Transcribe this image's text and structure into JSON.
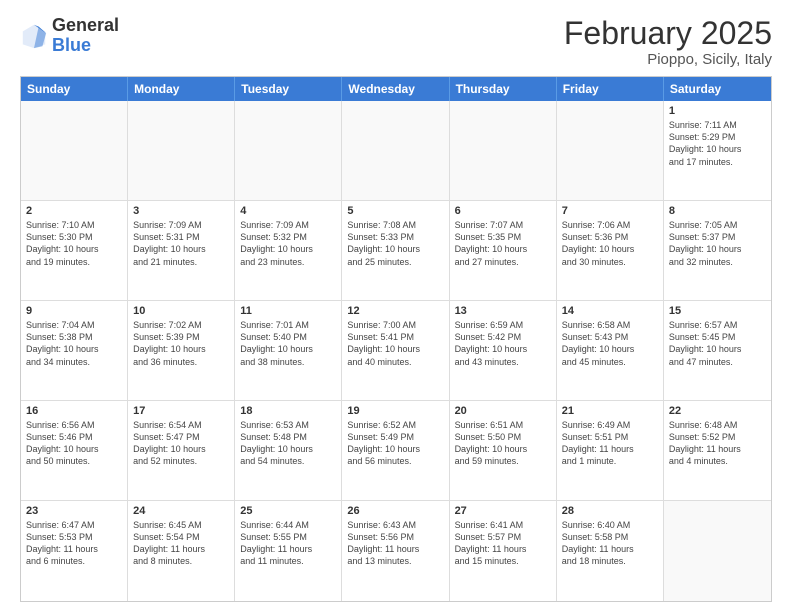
{
  "logo": {
    "general": "General",
    "blue": "Blue"
  },
  "header": {
    "title": "February 2025",
    "subtitle": "Pioppo, Sicily, Italy"
  },
  "weekdays": [
    "Sunday",
    "Monday",
    "Tuesday",
    "Wednesday",
    "Thursday",
    "Friday",
    "Saturday"
  ],
  "weeks": [
    [
      {
        "day": "",
        "text": "",
        "empty": true
      },
      {
        "day": "",
        "text": "",
        "empty": true
      },
      {
        "day": "",
        "text": "",
        "empty": true
      },
      {
        "day": "",
        "text": "",
        "empty": true
      },
      {
        "day": "",
        "text": "",
        "empty": true
      },
      {
        "day": "",
        "text": "",
        "empty": true
      },
      {
        "day": "1",
        "text": "Sunrise: 7:11 AM\nSunset: 5:29 PM\nDaylight: 10 hours\nand 17 minutes.",
        "empty": false
      }
    ],
    [
      {
        "day": "2",
        "text": "Sunrise: 7:10 AM\nSunset: 5:30 PM\nDaylight: 10 hours\nand 19 minutes.",
        "empty": false
      },
      {
        "day": "3",
        "text": "Sunrise: 7:09 AM\nSunset: 5:31 PM\nDaylight: 10 hours\nand 21 minutes.",
        "empty": false
      },
      {
        "day": "4",
        "text": "Sunrise: 7:09 AM\nSunset: 5:32 PM\nDaylight: 10 hours\nand 23 minutes.",
        "empty": false
      },
      {
        "day": "5",
        "text": "Sunrise: 7:08 AM\nSunset: 5:33 PM\nDaylight: 10 hours\nand 25 minutes.",
        "empty": false
      },
      {
        "day": "6",
        "text": "Sunrise: 7:07 AM\nSunset: 5:35 PM\nDaylight: 10 hours\nand 27 minutes.",
        "empty": false
      },
      {
        "day": "7",
        "text": "Sunrise: 7:06 AM\nSunset: 5:36 PM\nDaylight: 10 hours\nand 30 minutes.",
        "empty": false
      },
      {
        "day": "8",
        "text": "Sunrise: 7:05 AM\nSunset: 5:37 PM\nDaylight: 10 hours\nand 32 minutes.",
        "empty": false
      }
    ],
    [
      {
        "day": "9",
        "text": "Sunrise: 7:04 AM\nSunset: 5:38 PM\nDaylight: 10 hours\nand 34 minutes.",
        "empty": false
      },
      {
        "day": "10",
        "text": "Sunrise: 7:02 AM\nSunset: 5:39 PM\nDaylight: 10 hours\nand 36 minutes.",
        "empty": false
      },
      {
        "day": "11",
        "text": "Sunrise: 7:01 AM\nSunset: 5:40 PM\nDaylight: 10 hours\nand 38 minutes.",
        "empty": false
      },
      {
        "day": "12",
        "text": "Sunrise: 7:00 AM\nSunset: 5:41 PM\nDaylight: 10 hours\nand 40 minutes.",
        "empty": false
      },
      {
        "day": "13",
        "text": "Sunrise: 6:59 AM\nSunset: 5:42 PM\nDaylight: 10 hours\nand 43 minutes.",
        "empty": false
      },
      {
        "day": "14",
        "text": "Sunrise: 6:58 AM\nSunset: 5:43 PM\nDaylight: 10 hours\nand 45 minutes.",
        "empty": false
      },
      {
        "day": "15",
        "text": "Sunrise: 6:57 AM\nSunset: 5:45 PM\nDaylight: 10 hours\nand 47 minutes.",
        "empty": false
      }
    ],
    [
      {
        "day": "16",
        "text": "Sunrise: 6:56 AM\nSunset: 5:46 PM\nDaylight: 10 hours\nand 50 minutes.",
        "empty": false
      },
      {
        "day": "17",
        "text": "Sunrise: 6:54 AM\nSunset: 5:47 PM\nDaylight: 10 hours\nand 52 minutes.",
        "empty": false
      },
      {
        "day": "18",
        "text": "Sunrise: 6:53 AM\nSunset: 5:48 PM\nDaylight: 10 hours\nand 54 minutes.",
        "empty": false
      },
      {
        "day": "19",
        "text": "Sunrise: 6:52 AM\nSunset: 5:49 PM\nDaylight: 10 hours\nand 56 minutes.",
        "empty": false
      },
      {
        "day": "20",
        "text": "Sunrise: 6:51 AM\nSunset: 5:50 PM\nDaylight: 10 hours\nand 59 minutes.",
        "empty": false
      },
      {
        "day": "21",
        "text": "Sunrise: 6:49 AM\nSunset: 5:51 PM\nDaylight: 11 hours\nand 1 minute.",
        "empty": false
      },
      {
        "day": "22",
        "text": "Sunrise: 6:48 AM\nSunset: 5:52 PM\nDaylight: 11 hours\nand 4 minutes.",
        "empty": false
      }
    ],
    [
      {
        "day": "23",
        "text": "Sunrise: 6:47 AM\nSunset: 5:53 PM\nDaylight: 11 hours\nand 6 minutes.",
        "empty": false
      },
      {
        "day": "24",
        "text": "Sunrise: 6:45 AM\nSunset: 5:54 PM\nDaylight: 11 hours\nand 8 minutes.",
        "empty": false
      },
      {
        "day": "25",
        "text": "Sunrise: 6:44 AM\nSunset: 5:55 PM\nDaylight: 11 hours\nand 11 minutes.",
        "empty": false
      },
      {
        "day": "26",
        "text": "Sunrise: 6:43 AM\nSunset: 5:56 PM\nDaylight: 11 hours\nand 13 minutes.",
        "empty": false
      },
      {
        "day": "27",
        "text": "Sunrise: 6:41 AM\nSunset: 5:57 PM\nDaylight: 11 hours\nand 15 minutes.",
        "empty": false
      },
      {
        "day": "28",
        "text": "Sunrise: 6:40 AM\nSunset: 5:58 PM\nDaylight: 11 hours\nand 18 minutes.",
        "empty": false
      },
      {
        "day": "",
        "text": "",
        "empty": true
      }
    ]
  ]
}
